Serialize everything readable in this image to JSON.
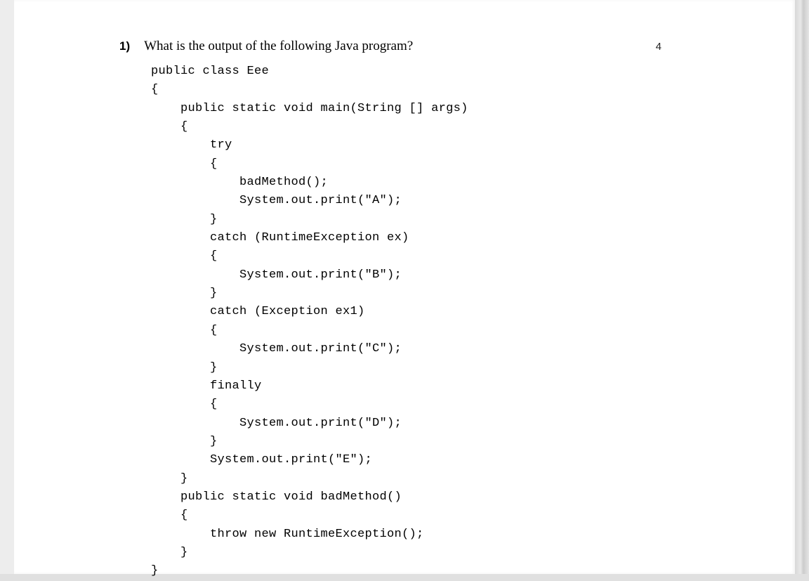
{
  "question": {
    "number": "1)",
    "text": "What is the output of the following Java program?",
    "points": "4"
  },
  "code": {
    "lines": [
      "public class Eee",
      "{",
      "    public static void main(String [] args)",
      "    {",
      "        try",
      "        {",
      "            badMethod();",
      "            System.out.print(\"A\");",
      "        }",
      "        catch (RuntimeException ex)",
      "        {",
      "            System.out.print(\"B\");",
      "        }",
      "        catch (Exception ex1)",
      "        {",
      "            System.out.print(\"C\");",
      "        }",
      "        finally",
      "        {",
      "            System.out.print(\"D\");",
      "        }",
      "        System.out.print(\"E\");",
      "    }",
      "    public static void badMethod()",
      "    {",
      "        throw new RuntimeException();",
      "    }",
      "}"
    ]
  }
}
